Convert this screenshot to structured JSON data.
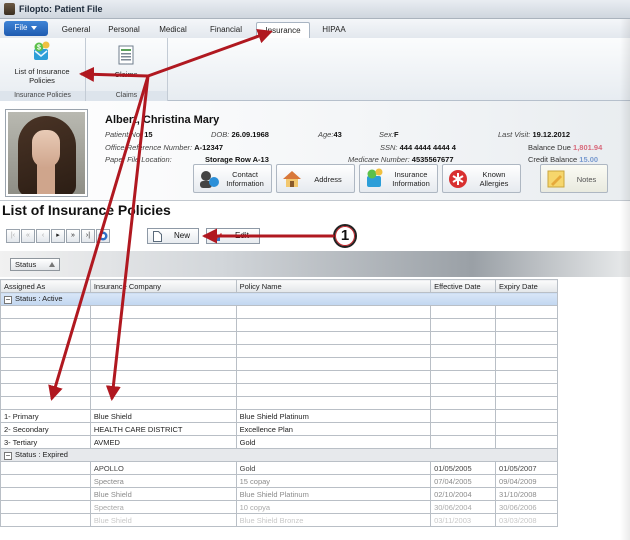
{
  "window": {
    "title": "Filopto: Patient File"
  },
  "tabs": {
    "file": "File",
    "items": [
      "General",
      "Personal",
      "Medical",
      "Financial",
      "Insurance",
      "HIPAA"
    ],
    "active": "Insurance"
  },
  "ribbon": {
    "list_policies": "List of Insurance Policies",
    "claims": "Claims",
    "group1": "Insurance Policies",
    "group2": "Claims"
  },
  "patient": {
    "name": "Albert, Christina Mary",
    "patient_no_label": "Patient No:",
    "patient_no": "15",
    "dob_label": "DOB:",
    "dob": "26.09.1968",
    "age_label": "Age:",
    "age": "43",
    "sex_label": "Sex:",
    "sex": "F",
    "last_visit_label": "Last Visit:",
    "last_visit": "19.12.2012",
    "office_ref_label": "Office Reference Number:",
    "office_ref": "A-12347",
    "ssn_label": "SSN:",
    "ssn": "444 4444 4444 4",
    "balance_due_label": "Balance Due",
    "balance_due": "1,801.94",
    "paper_file_label": "Paper File Location:",
    "paper_file": "Storage Row A-13",
    "medicare_label": "Medicare Number:",
    "medicare": "4535567677",
    "credit_balance_label": "Credit Balance",
    "credit_balance": "15.00"
  },
  "patient_buttons": {
    "contact": "Contact Information",
    "address": "Address",
    "insurance": "Insurance Information",
    "allergies": "Known Allergies",
    "notes": "Notes"
  },
  "page": {
    "title": "List of Insurance Policies"
  },
  "toolbar": {
    "new": "New",
    "edit": "Edit"
  },
  "grouping": {
    "chip": "Status"
  },
  "callout": "1",
  "grid": {
    "columns": [
      "Assigned As",
      "Insurance Company",
      "Policy Name",
      "Effective Date",
      "Expiry Date"
    ],
    "group_active": "Status : Active",
    "active_rows": [
      {
        "assigned": "1- Primary",
        "company": "Blue Shield",
        "policy": "Blue Shield Platinum",
        "effective": "",
        "expiry": ""
      },
      {
        "assigned": "2- Secondary",
        "company": "HEALTH CARE DISTRICT",
        "policy": "Excellence Plan",
        "effective": "",
        "expiry": ""
      },
      {
        "assigned": "3- Tertiary",
        "company": "AVMED",
        "policy": "Gold",
        "effective": "",
        "expiry": ""
      }
    ],
    "group_expired": "Status : Expired",
    "expired_rows": [
      {
        "assigned": "",
        "company": "APOLLO",
        "policy": "Gold",
        "effective": "01/05/2005",
        "expiry": "01/05/2007"
      },
      {
        "assigned": "",
        "company": "Spectera",
        "policy": "15 copay",
        "effective": "07/04/2005",
        "expiry": "09/04/2009"
      },
      {
        "assigned": "",
        "company": "Blue Shield",
        "policy": "Blue Shield Platinum",
        "effective": "02/10/2004",
        "expiry": "31/10/2008"
      },
      {
        "assigned": "",
        "company": "Spectera",
        "policy": "10 copya",
        "effective": "30/06/2004",
        "expiry": "30/06/2006"
      },
      {
        "assigned": "",
        "company": "Blue Shield",
        "policy": "Blue Shield Bronze",
        "effective": "03/11/2003",
        "expiry": "03/03/2008"
      }
    ]
  }
}
